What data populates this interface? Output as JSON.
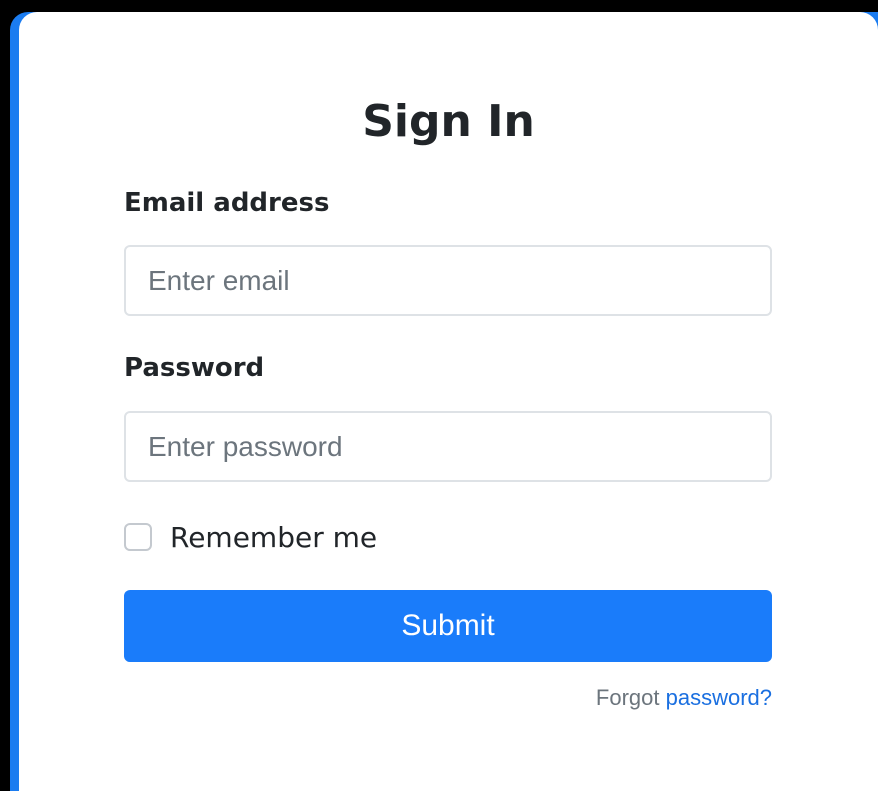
{
  "form": {
    "title": "Sign In",
    "email": {
      "label": "Email address",
      "placeholder": "Enter email",
      "value": ""
    },
    "password": {
      "label": "Password",
      "placeholder": "Enter password",
      "value": ""
    },
    "remember": {
      "label": "Remember me",
      "checked": false
    },
    "submit_label": "Submit",
    "forgot": {
      "prefix": "Forgot",
      "link_text": "password?"
    }
  },
  "colors": {
    "accent": "#1a7cfa",
    "link": "#1a6fe0",
    "background": "#000000",
    "card": "#ffffff"
  }
}
